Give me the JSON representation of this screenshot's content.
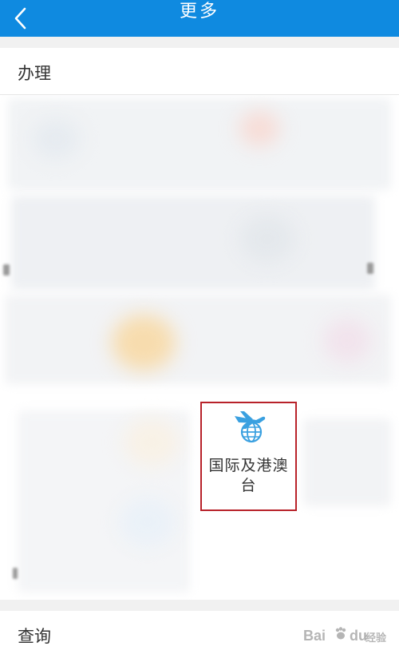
{
  "header": {
    "title": "更多",
    "back_icon": "chevron-left-icon",
    "background_color": "#0f8ae0"
  },
  "sections": {
    "banli": {
      "title": "办理"
    },
    "chaxun": {
      "title": "查询"
    }
  },
  "highlighted_tile": {
    "label_line1": "国际及港澳",
    "label_line2": "台",
    "icon": "airplane-globe-icon",
    "icon_color": "#3aa0e0",
    "highlight_color": "#b8222a"
  },
  "watermark": {
    "brand_part1": "Bai",
    "brand_part2": "du",
    "brand_part3": "经验",
    "icon": "paw-icon"
  }
}
